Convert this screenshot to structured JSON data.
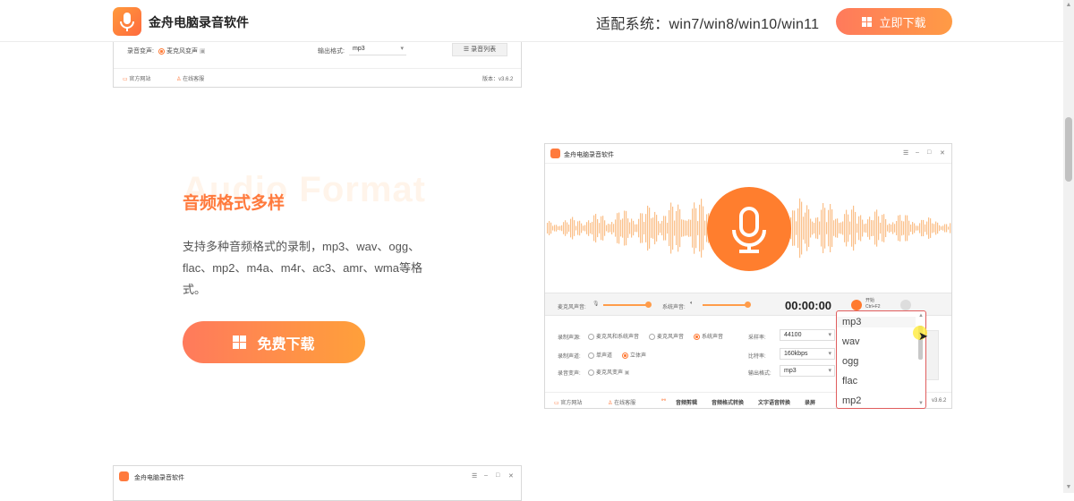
{
  "header": {
    "brand": "金舟电脑录音软件",
    "compat": "适配系统：win7/win8/win10/win11",
    "download": "立即下载"
  },
  "top_shot": {
    "voice_change_label": "录音变声:",
    "voice_change_value": "麦克风变声",
    "output_label": "输出格式:",
    "output_value": "mp3",
    "list_button": "录音列表",
    "site": "官方网站",
    "support": "在线客服",
    "version": "版本：v3.6.2"
  },
  "feature": {
    "ghost": "Audio Format",
    "title": "音频格式多样",
    "desc": "支持多种音频格式的录制，mp3、wav、ogg、flac、mp2、m4a、m4r、ac3、amr、wma等格式。",
    "button": "免费下载"
  },
  "app": {
    "title": "金舟电脑录音软件",
    "mic_label": "麦克风声音:",
    "sys_label": "系统声音:",
    "timer": "00:00:00",
    "start": "开始",
    "start_shortcut": "Ctrl+F2",
    "source_label": "录制声源:",
    "source_opts": [
      "麦克风和系统声音",
      "麦克风声音",
      "系统声音"
    ],
    "channel_label": "录制声道:",
    "channel_opts": [
      "单声道",
      "立体声"
    ],
    "voice_label": "录音变声:",
    "voice_opt": "麦克风变声",
    "rate_label": "采样率:",
    "rate_value": "44100",
    "bitrate_label": "比特率:",
    "bitrate_value": "160kbps",
    "format_label": "输出格式:",
    "format_value": "mp3",
    "footer": [
      "官方网站",
      "在线客服",
      "音频剪辑",
      "音频格式转换",
      "文字语音转换",
      "录屏"
    ],
    "version": "v3.6.2"
  },
  "dropdown": {
    "items": [
      "mp3",
      "wav",
      "ogg",
      "flac",
      "mp2"
    ]
  },
  "bottom_shot": {
    "title": "金舟电脑录音软件"
  },
  "colors": {
    "accent": "#ff7a3d",
    "wave": "#fbc089",
    "highlight": "#e05d5d"
  }
}
